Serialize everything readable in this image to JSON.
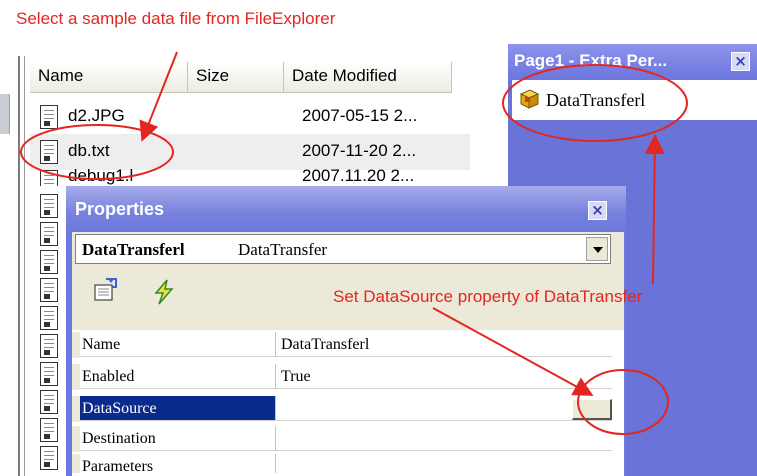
{
  "annotations": {
    "top_note": "Select a sample data file from FileExplorer",
    "datasource_note": "Set DataSource property of DataTransfer"
  },
  "file_explorer": {
    "columns": [
      "Name",
      "Size",
      "Date Modified"
    ],
    "files": [
      {
        "name": "d2.JPG",
        "date": "2007-05-15 2..."
      },
      {
        "name": "db.txt",
        "date": "2007-11-20 2..."
      },
      {
        "name": "debug1.l",
        "date": "2007.11.20 2..."
      }
    ],
    "selected_file": "db.txt",
    "icon": "file-icon"
  },
  "page_panel": {
    "title": "Page1 - Extra Per...",
    "close_label": "×",
    "item_label": "DataTransferl",
    "item_icon": "component-icon"
  },
  "properties": {
    "title": "Properties",
    "close_label": "×",
    "object_name": "DataTransferl",
    "object_type": "DataTransfer",
    "toolbar_icons": [
      "properties-icon",
      "events-lightning-icon"
    ],
    "rows": [
      {
        "name": "Name",
        "value": "DataTransferl"
      },
      {
        "name": "Enabled",
        "value": "True"
      },
      {
        "name": "DataSource",
        "value": ""
      },
      {
        "name": "Destination",
        "value": ""
      },
      {
        "name": "Parameters",
        "value": ""
      }
    ],
    "selected_row": "DataSource"
  },
  "colors": {
    "annotation_red": "#e32620",
    "panel_blue": "#6d78de",
    "selection_navy": "#0b2a8e"
  }
}
